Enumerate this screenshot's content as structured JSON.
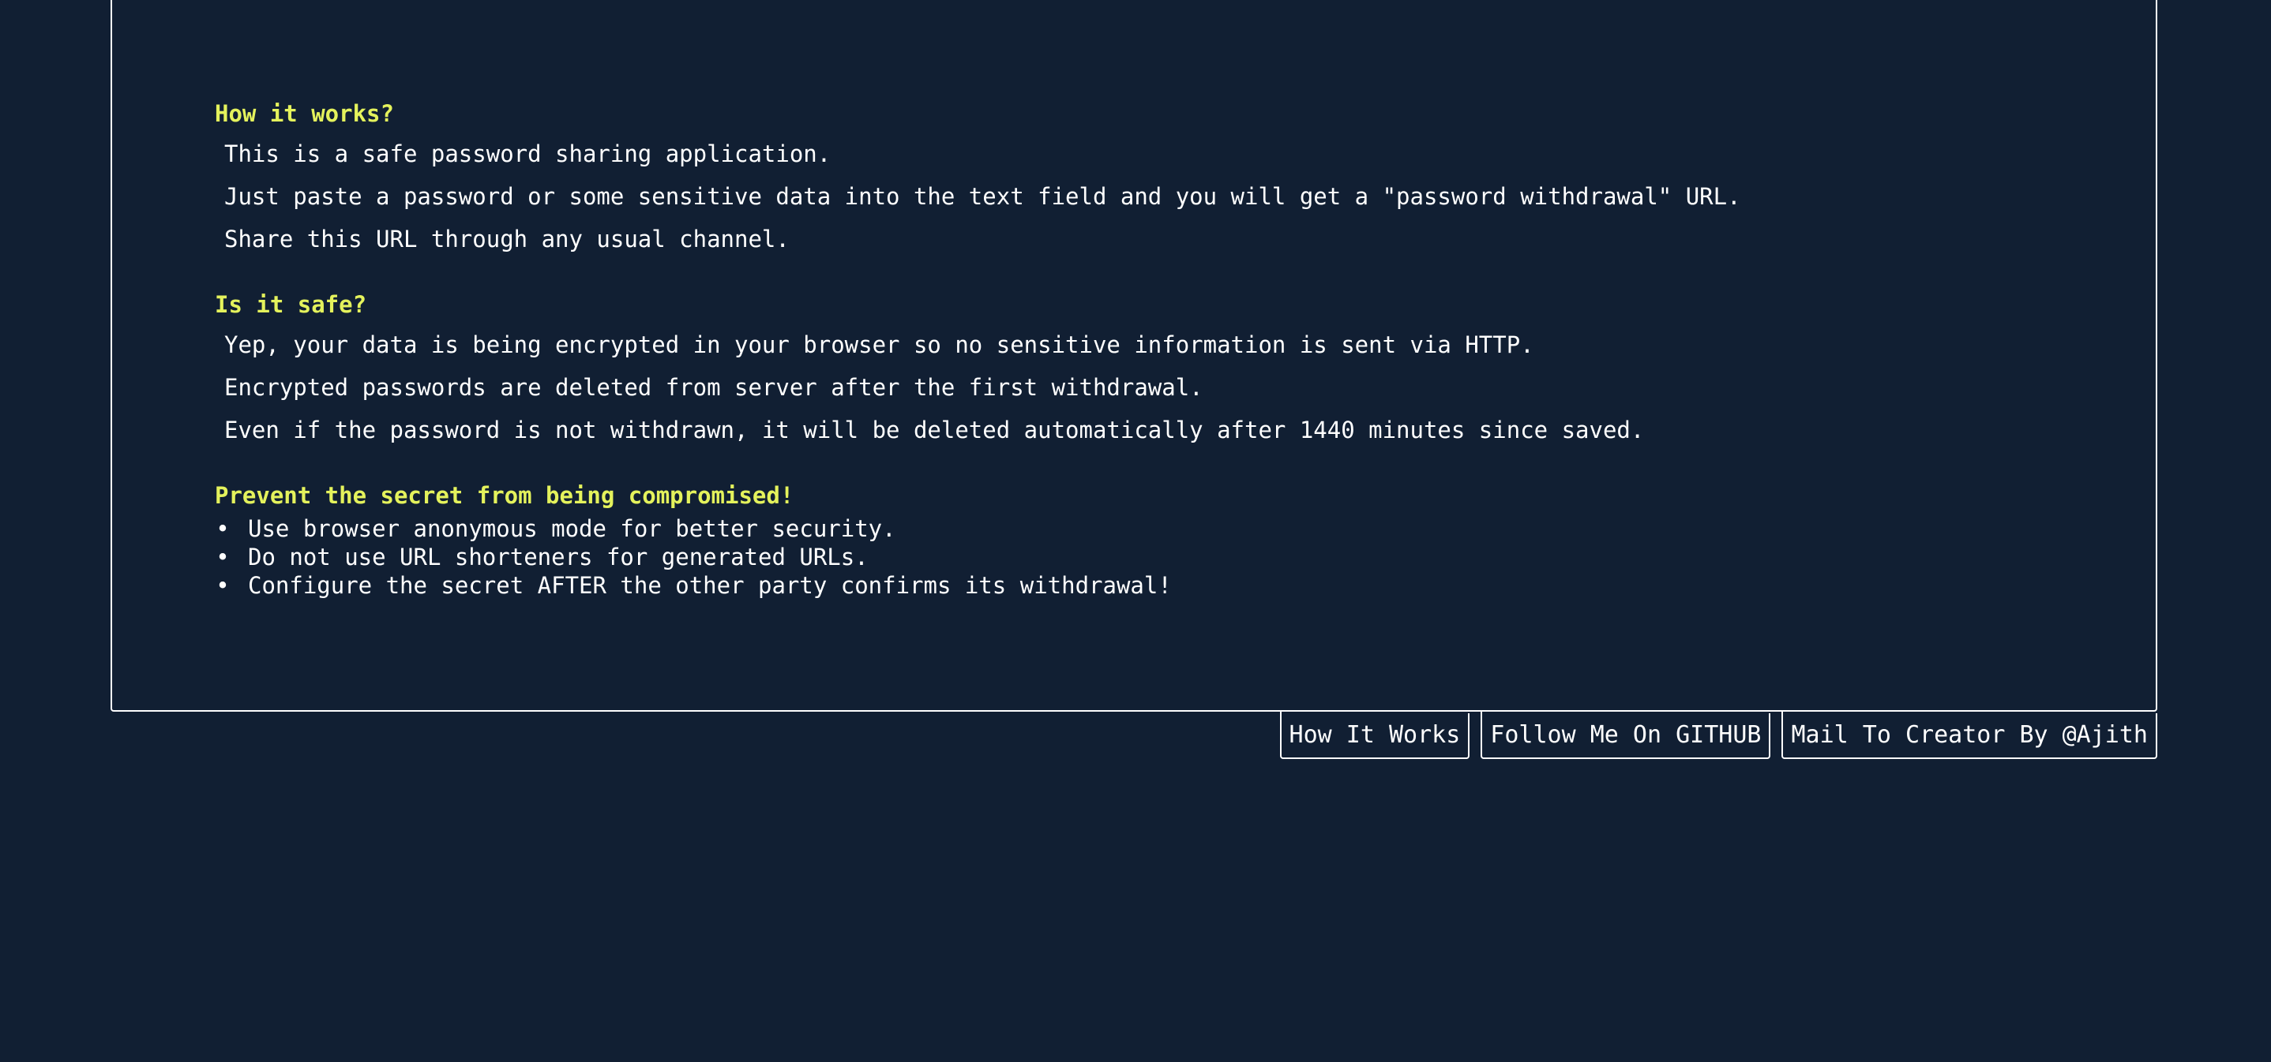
{
  "sections": [
    {
      "title": "How it works?",
      "lines": [
        "This is a safe password sharing application.",
        "Just paste a password or some sensitive data into the text field and you will get a \"password withdrawal\" URL.",
        "Share this URL through any usual channel."
      ]
    },
    {
      "title": "Is it safe?",
      "lines": [
        "Yep, your data is being encrypted in your browser so no sensitive information is sent via HTTP.",
        "Encrypted passwords are deleted from server after the first withdrawal.",
        "Even if the password is not withdrawn, it will be deleted automatically after 1440 minutes since saved."
      ]
    },
    {
      "title": "Prevent the secret from being compromised!",
      "tips": [
        "Use browser anonymous mode for better security.",
        "Do not use URL shorteners for generated URLs.",
        "Configure the secret AFTER the other party confirms its withdrawal!"
      ]
    }
  ],
  "bullet_char": "•",
  "footer": {
    "how_it_works": "How It Works",
    "github": "Follow Me On GITHUB",
    "mail": "Mail To Creator By @Ajith"
  },
  "colors": {
    "background": "#111f33",
    "heading": "#e4f25c",
    "text": "#ffffff"
  }
}
